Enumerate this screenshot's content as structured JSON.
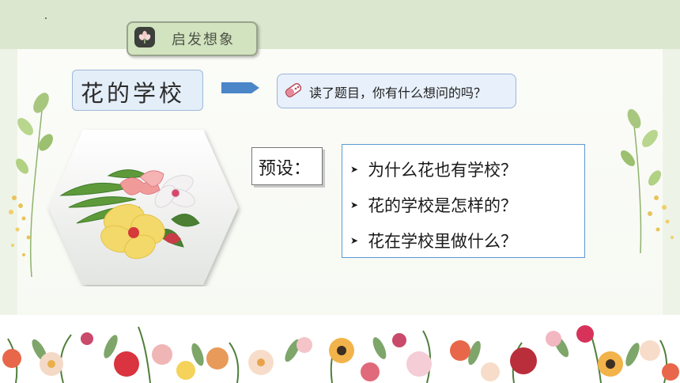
{
  "header": {
    "label": "启发想象",
    "icon": "flower-icon"
  },
  "title": {
    "text": "花的学校"
  },
  "question": {
    "text": "读了题目，你有什么想问的吗？",
    "icon": "pencil-eraser-icon"
  },
  "preset": {
    "label": "预设："
  },
  "presets": [
    {
      "text": "为什么花也有学校？"
    },
    {
      "text": "花的学校是怎样的？"
    },
    {
      "text": "花在学校里做什么？"
    }
  ],
  "colors": {
    "accent_green": "#d2e3bf",
    "card_border_blue": "#5b9bd5",
    "arrow_blue": "#4a86c8"
  }
}
